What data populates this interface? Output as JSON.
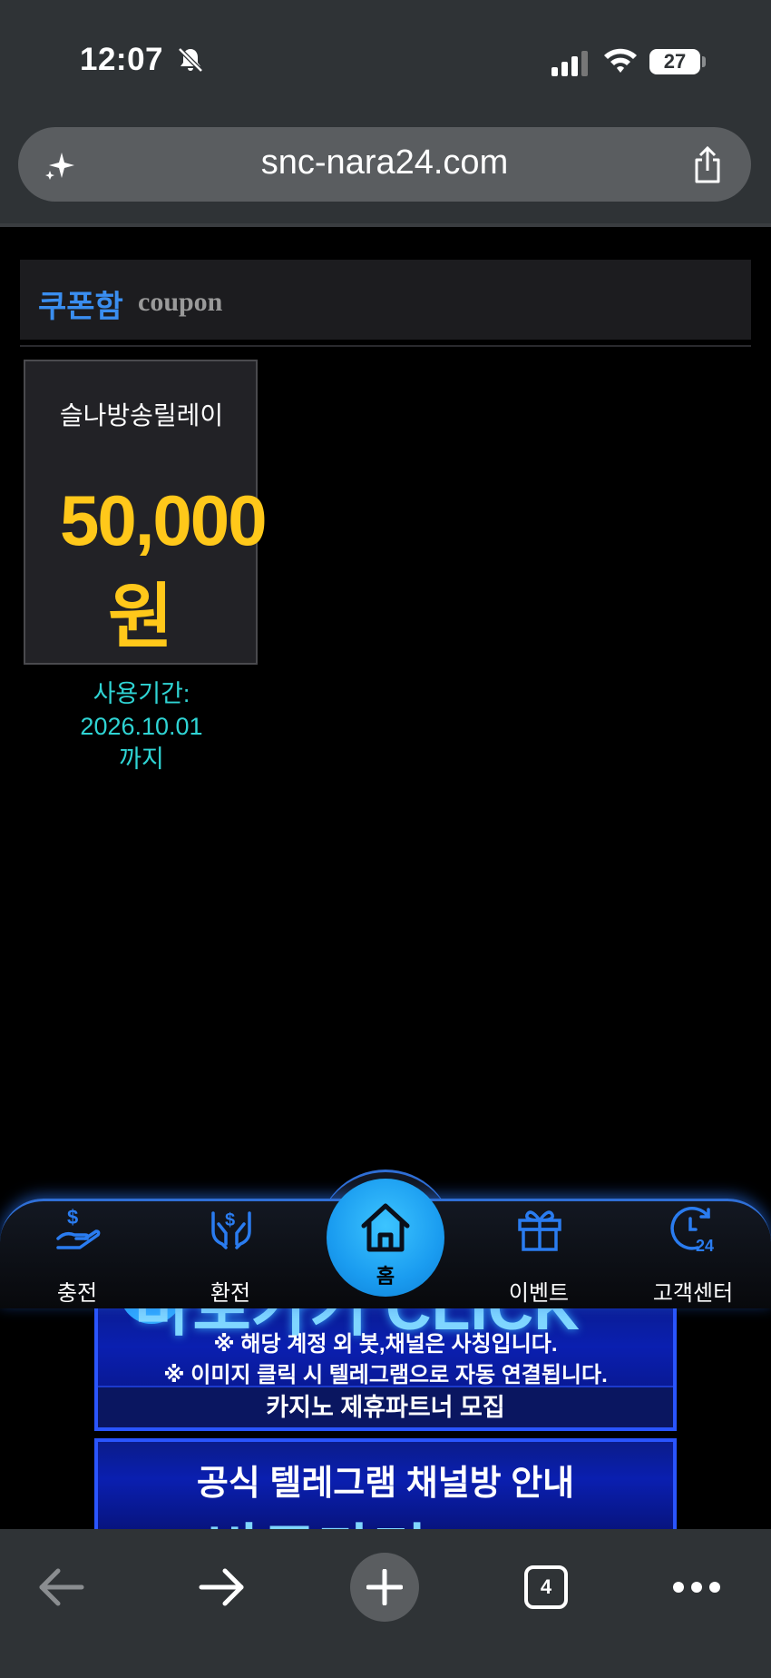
{
  "status_bar": {
    "time": "12:07",
    "battery": "27"
  },
  "browser": {
    "url": "snc-nara24.com",
    "open_tabs": "4"
  },
  "coupon_section": {
    "title_ko": "쿠폰함",
    "title_en": "coupon"
  },
  "coupon": {
    "name": "슬나방송릴레이",
    "amount": "50,000",
    "currency": "원",
    "period_label": "사용기간:",
    "period_date": "2026.10.01",
    "period_suffix": "까지"
  },
  "banners": {
    "line1": "※ 해당 계정 외 봇,채널은 사칭입니다.",
    "line2": "※ 이미지 클릭 시 텔레그램으로 자동 연결됩니다.",
    "footer": "카지노 제휴파트너 모집",
    "banner2_title": "공식 텔레그램 채널방 안내",
    "banner1_cut": "바로가기 CLICK",
    "banner2_cut": "바로가기 CLICK"
  },
  "site_nav": {
    "items": [
      {
        "label": "충전",
        "icon": "deposit-icon"
      },
      {
        "label": "환전",
        "icon": "withdraw-icon"
      },
      {
        "label": "홈",
        "icon": "home-icon"
      },
      {
        "label": "이벤트",
        "icon": "gift-icon"
      },
      {
        "label": "고객센터",
        "icon": "support-24-icon"
      }
    ]
  },
  "colors": {
    "accent_blue": "#3a8ef0",
    "amount_yellow": "#ffc81a",
    "period_cyan": "#2fd4d4",
    "nav_blue": "#1a9cf0"
  }
}
